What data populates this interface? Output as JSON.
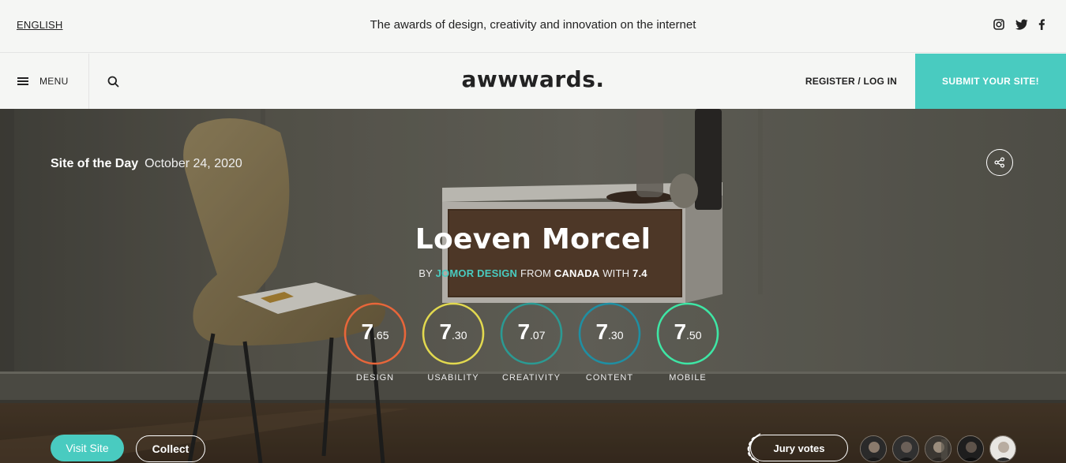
{
  "topbar": {
    "language": "ENGLISH",
    "tagline": "The awards of design, creativity and innovation on the internet",
    "socials": [
      "instagram-icon",
      "twitter-icon",
      "facebook-icon"
    ]
  },
  "nav": {
    "menu_label": "MENU",
    "logo": "awwwards.",
    "login_label": "REGISTER / LOG IN",
    "submit_label": "SUBMIT YOUR SITE!"
  },
  "hero": {
    "award": "Site of the Day",
    "date": "October 24, 2020",
    "title": "Loeven Morcel",
    "by_prefix": "BY",
    "studio": "JOMOR DESIGN",
    "from_label": "FROM",
    "country": "CANADA",
    "with_label": "WITH",
    "overall": "7.4",
    "scores": [
      {
        "label": "DESIGN",
        "whole": "7",
        "decimal": ".65",
        "value": 7.65,
        "color": "#e8663a"
      },
      {
        "label": "USABILITY",
        "whole": "7",
        "decimal": ".30",
        "value": 7.3,
        "color": "#e2d94f"
      },
      {
        "label": "CREATIVITY",
        "whole": "7",
        "decimal": ".07",
        "value": 7.07,
        "color": "#2b9a93"
      },
      {
        "label": "CONTENT",
        "whole": "7",
        "decimal": ".30",
        "value": 7.3,
        "color": "#1f8fa3"
      },
      {
        "label": "MOBILE",
        "whole": "7",
        "decimal": ".50",
        "value": 7.5,
        "color": "#3ee6a5"
      }
    ],
    "visit_label": "Visit Site",
    "collect_label": "Collect",
    "jury_label": "Jury votes"
  },
  "colors": {
    "accent": "#49cbc0"
  }
}
